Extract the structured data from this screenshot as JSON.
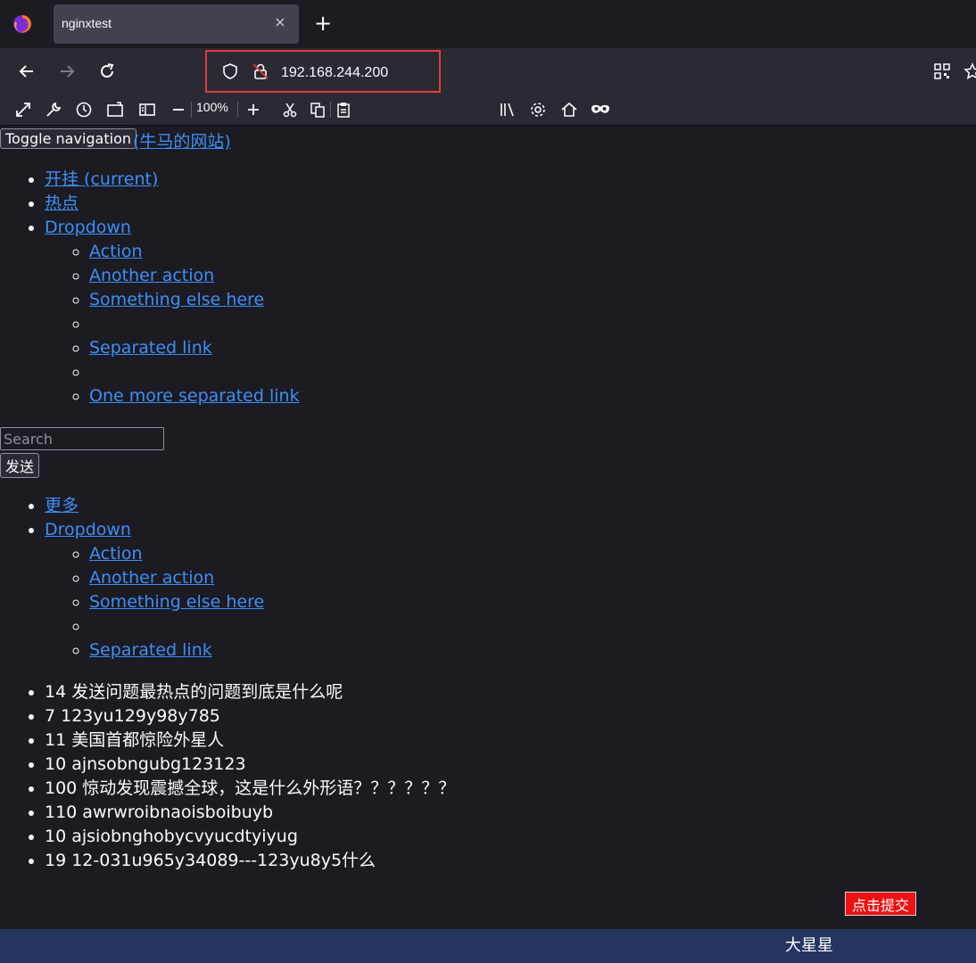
{
  "browser": {
    "tab_title": "nginxtest",
    "tab_close": "×",
    "new_tab": "+",
    "url": "192.168.244.200",
    "zoom": "100%"
  },
  "page": {
    "toggle_label": "Toggle navigation",
    "brand": "(牛马的网站)",
    "nav1": {
      "items": [
        "开挂 (current)",
        "热点",
        "Dropdown"
      ],
      "dropdown": [
        "Action",
        "Another action",
        "Something else here",
        "",
        "Separated link",
        "",
        "One more separated link"
      ]
    },
    "search_placeholder": "Search",
    "send_label": "发送",
    "nav2": {
      "items": [
        "更多",
        "Dropdown"
      ],
      "dropdown": [
        "Action",
        "Another action",
        "Something else here",
        "",
        "Separated link"
      ]
    },
    "hot_list": [
      "14 发送问题最热点的问题到底是什么呢",
      "7 123yu129y98y785",
      "11 美国首都惊险外星人",
      "10 ajnsobngubg123123",
      "100 惊动发现震撼全球，这是什么外形语？？？？？？",
      "110 awrwroibnaoisboibuyb",
      "10 ajsiobnghobycvyucdtyiyug",
      "19 12-031u965y34089---123yu8y5什么"
    ],
    "submit_label": "点击提交",
    "footer_text": "大星星"
  }
}
